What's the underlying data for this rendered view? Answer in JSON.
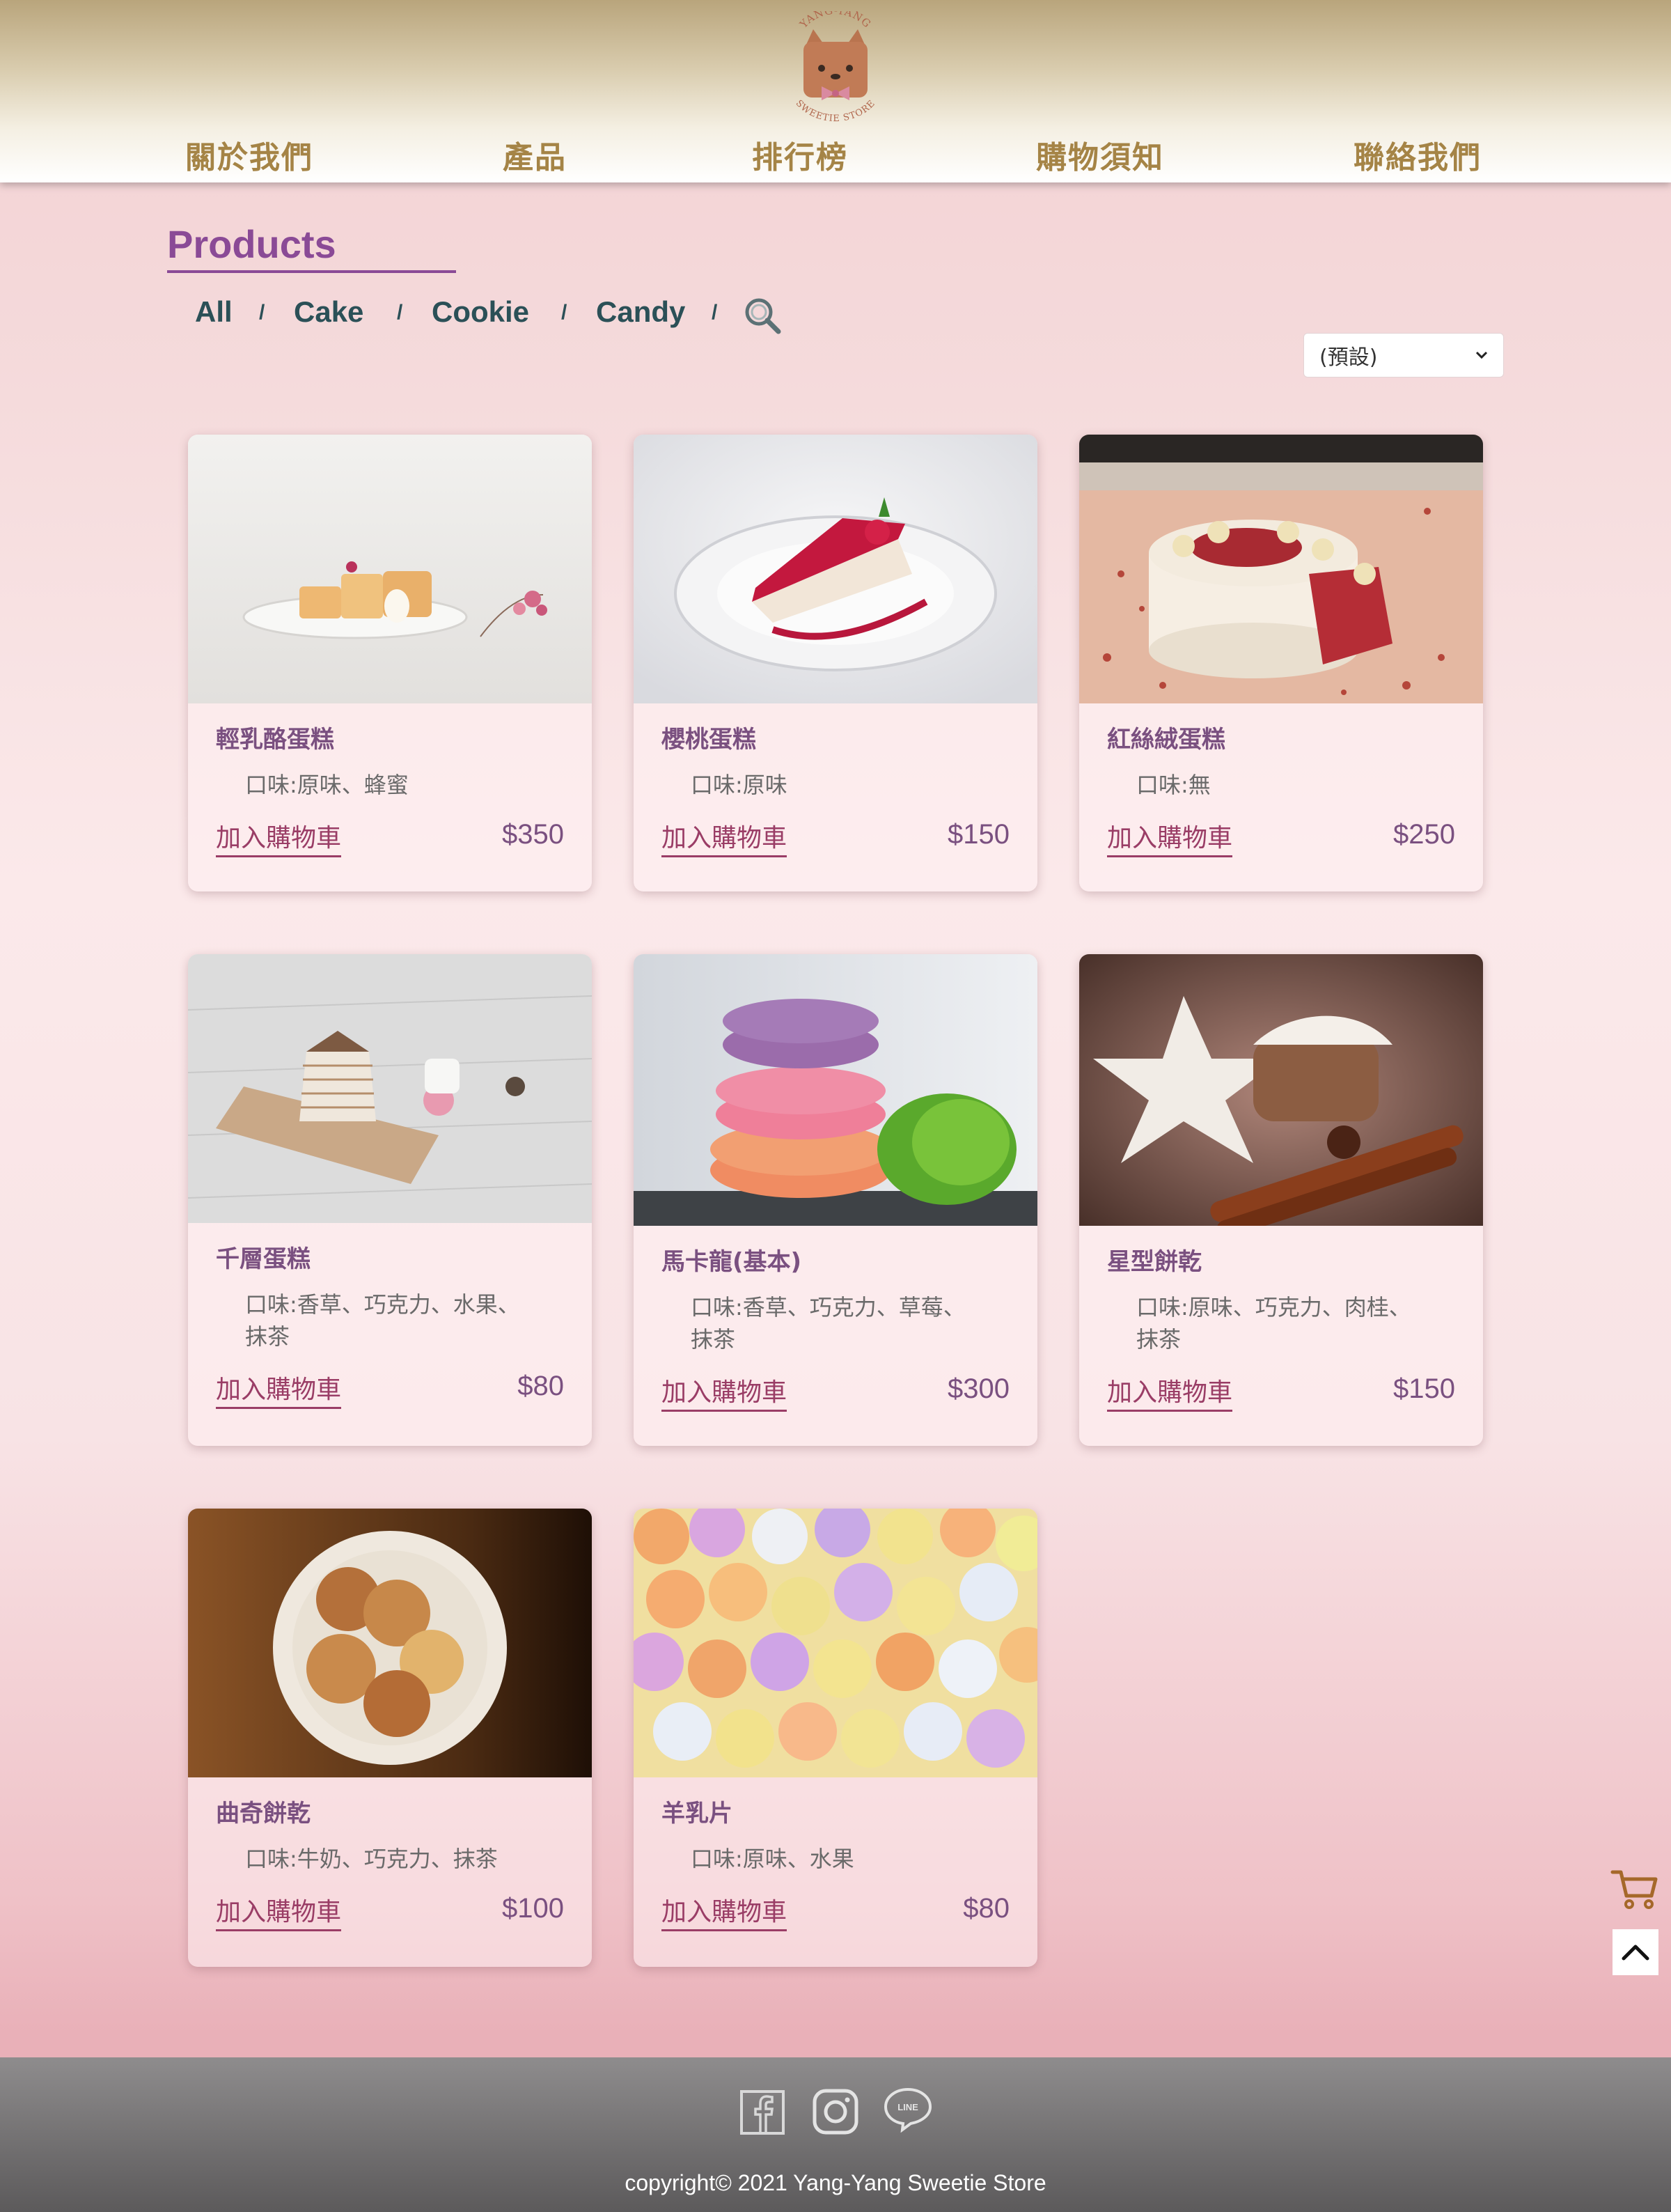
{
  "brand": {
    "logo_text_top": "YANG-YANG",
    "logo_text_bottom": "SWEETIE STORE"
  },
  "nav": [
    {
      "label": "關於我們"
    },
    {
      "label": "產品"
    },
    {
      "label": "排行榜"
    },
    {
      "label": "購物須知"
    },
    {
      "label": "聯絡我們"
    }
  ],
  "section_title": "Products",
  "filters": [
    {
      "label": "All"
    },
    {
      "label": "Cake"
    },
    {
      "label": "Cookie"
    },
    {
      "label": "Candy"
    }
  ],
  "filter_separator": "/",
  "sort": {
    "selected": "(預設)"
  },
  "add_to_cart_label": "加入購物車",
  "products": [
    {
      "name": "輕乳酪蛋糕",
      "flavor": "口味:原味、蜂蜜",
      "price": "$350",
      "image": "cheesecake-photo"
    },
    {
      "name": "櫻桃蛋糕",
      "flavor": "口味:原味",
      "price": "$150",
      "image": "cherry-cake-photo"
    },
    {
      "name": "紅絲絨蛋糕",
      "flavor": "口味:無",
      "price": "$250",
      "image": "red-velvet-photo"
    },
    {
      "name": "千層蛋糕",
      "flavor": "口味:香草、巧克力、水果、抹茶",
      "price": "$80",
      "image": "crepe-cake-photo"
    },
    {
      "name": "馬卡龍(基本)",
      "flavor": "口味:香草、巧克力、草莓、抹茶",
      "price": "$300",
      "image": "macaron-photo"
    },
    {
      "name": "星型餅乾",
      "flavor": "口味:原味、巧克力、肉桂、抹茶",
      "price": "$150",
      "image": "star-cookie-photo"
    },
    {
      "name": "曲奇餅乾",
      "flavor": "口味:牛奶、巧克力、抹茶",
      "price": "$100",
      "image": "cookies-bowl-photo"
    },
    {
      "name": "羊乳片",
      "flavor": "口味:原味、水果",
      "price": "$80",
      "image": "heart-candy-photo"
    }
  ],
  "footer": {
    "copyright": "copyright© 2021 Yang-Yang Sweetie Store",
    "social": [
      "facebook-icon",
      "instagram-icon",
      "line-icon"
    ],
    "line_text": "LINE"
  },
  "colors": {
    "accent": "#8a4a96",
    "nav": "#a58446",
    "filter": "#2b5057",
    "add_link": "#9a3d66"
  }
}
